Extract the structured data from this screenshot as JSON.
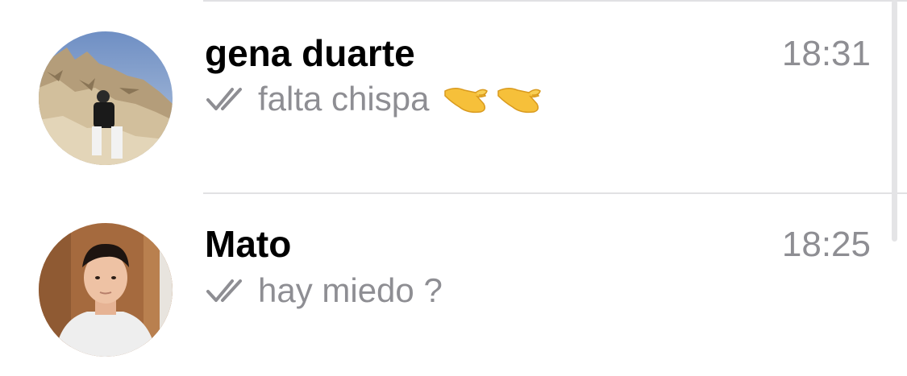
{
  "chats": [
    {
      "name": "gena duarte",
      "time": "18:31",
      "preview": "falta chispa",
      "preview_icons": [
        "double-check-icon",
        "pinch-hand-emoji",
        "pinch-hand-emoji"
      ],
      "avatar": "photo of person sitting on rocky cliffs under blue sky"
    },
    {
      "name": "Mato",
      "time": "18:25",
      "preview": "hay miedo ?",
      "preview_icons": [
        "double-check-icon"
      ],
      "avatar": "portrait photo of young man in white shirt against wooden wall"
    }
  ],
  "colors": {
    "name": "#000000",
    "secondary_text": "#8e8e93",
    "divider": "#e1e1e3",
    "emoji": "#f6c03a"
  }
}
